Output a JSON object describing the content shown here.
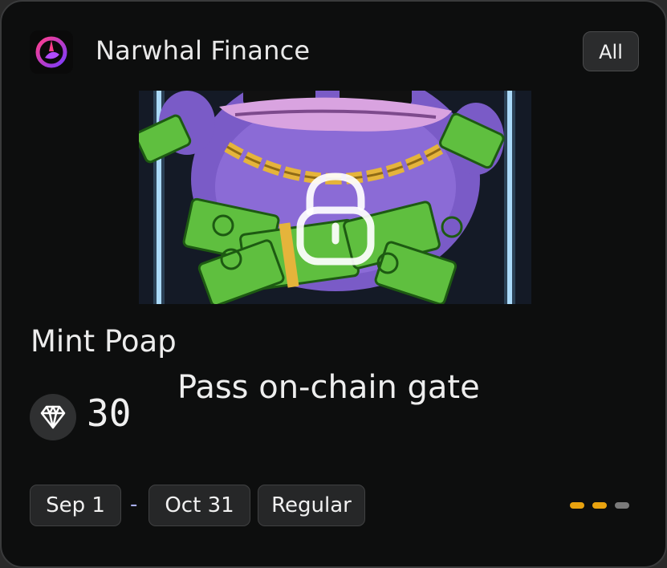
{
  "app": {
    "name": "Narwhal Finance",
    "logo_icon": "narwhal-logo-icon"
  },
  "filter": {
    "label": "All"
  },
  "quest": {
    "image_icon": "frog-money-artwork",
    "lock_icon": "unlock-icon",
    "title": "Mint Poap",
    "reward_icon": "diamond-icon",
    "points": "30",
    "requirement": "Pass on-chain gate",
    "start_date": "Sep 1",
    "separator": "-",
    "end_date": "Oct 31",
    "type": "Regular"
  },
  "pagination": {
    "dots": [
      {
        "state": "active",
        "color": "#e8a20f"
      },
      {
        "state": "active",
        "color": "#e8a20f"
      },
      {
        "state": "inactive",
        "color": "#7a7a7a"
      }
    ]
  },
  "colors": {
    "card_bg": "#0d0e0e",
    "accent": "#e8a20f"
  }
}
